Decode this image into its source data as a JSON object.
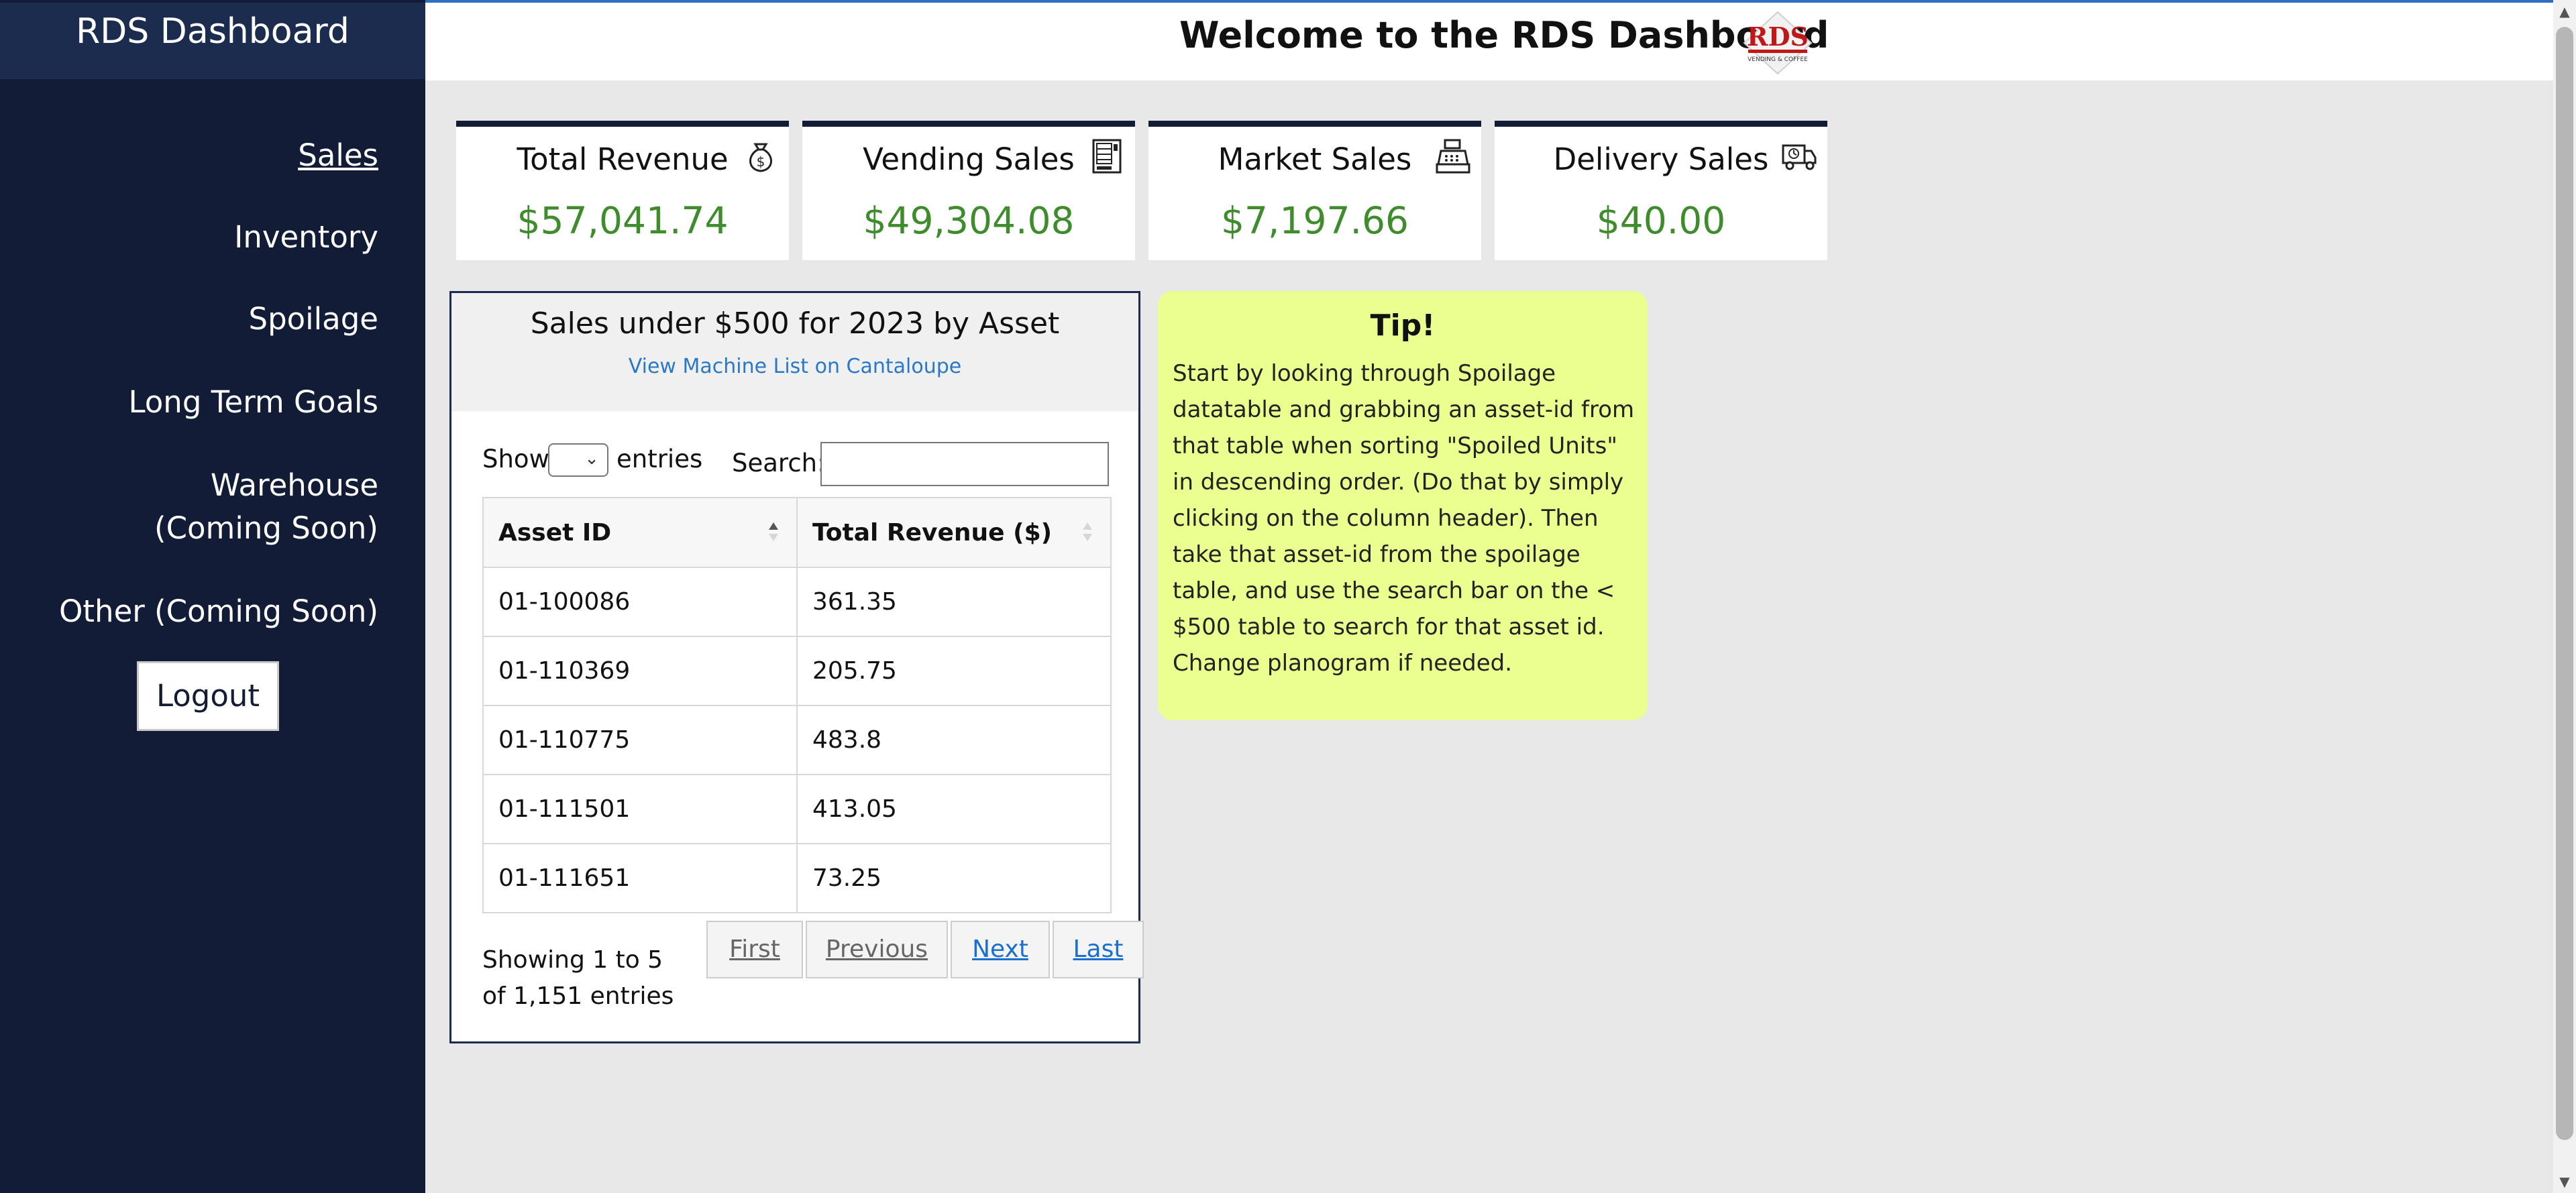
{
  "sidebar": {
    "title": "RDS Dashboard",
    "items": [
      {
        "label": "Sales",
        "active": true
      },
      {
        "label": "Inventory"
      },
      {
        "label": "Spoilage"
      },
      {
        "label": "Long Term Goals"
      },
      {
        "label": "Warehouse (Coming Soon)"
      },
      {
        "label": "Other (Coming Soon)"
      }
    ],
    "logout_label": "Logout"
  },
  "header": {
    "title": "Welcome to the RDS Dashboard",
    "logo_text": "RDS",
    "logo_subtext": "VENDING & COFFEE"
  },
  "cards": [
    {
      "title": "Total Revenue",
      "value": "$57,041.74",
      "icon": "money-bag-icon"
    },
    {
      "title": "Vending Sales",
      "value": "$49,304.08",
      "icon": "vending-machine-icon"
    },
    {
      "title": "Market Sales",
      "value": "$7,197.66",
      "icon": "cash-register-icon"
    },
    {
      "title": "Delivery Sales",
      "value": "$40.00",
      "icon": "delivery-truck-icon"
    }
  ],
  "colors": {
    "sidebar": "#121c36",
    "value_green": "#3e8c2c",
    "link_blue": "#2a78c8",
    "tip_bg": "#eaff90"
  },
  "sales_table": {
    "title": "Sales under $500 for 2023 by Asset",
    "link": "View Machine List on Cantaloupe",
    "show_label": "Show",
    "entries_label": "entries",
    "search_label": "Search:",
    "search_value": "",
    "columns": [
      "Asset ID",
      "Total Revenue ($)"
    ],
    "rows": [
      [
        "01-100086",
        "361.35"
      ],
      [
        "01-110369",
        "205.75"
      ],
      [
        "01-110775",
        "483.8"
      ],
      [
        "01-111501",
        "413.05"
      ],
      [
        "01-111651",
        "73.25"
      ]
    ],
    "info_line1": "Showing 1 to 5",
    "info_line2": "of 1,151 entries",
    "pagination": {
      "first": "First",
      "previous": "Previous",
      "next": "Next",
      "last": "Last"
    }
  },
  "tip": {
    "title": "Tip!",
    "body": "Start by looking through Spoilage datatable and grabbing an asset-id from that table when sorting \"Spoiled Units\" in descending order. (Do that by simply clicking on the column header). Then take that asset-id from the spoilage table, and use the search bar on the < $500 table to search for that asset id. Change planogram if needed."
  }
}
